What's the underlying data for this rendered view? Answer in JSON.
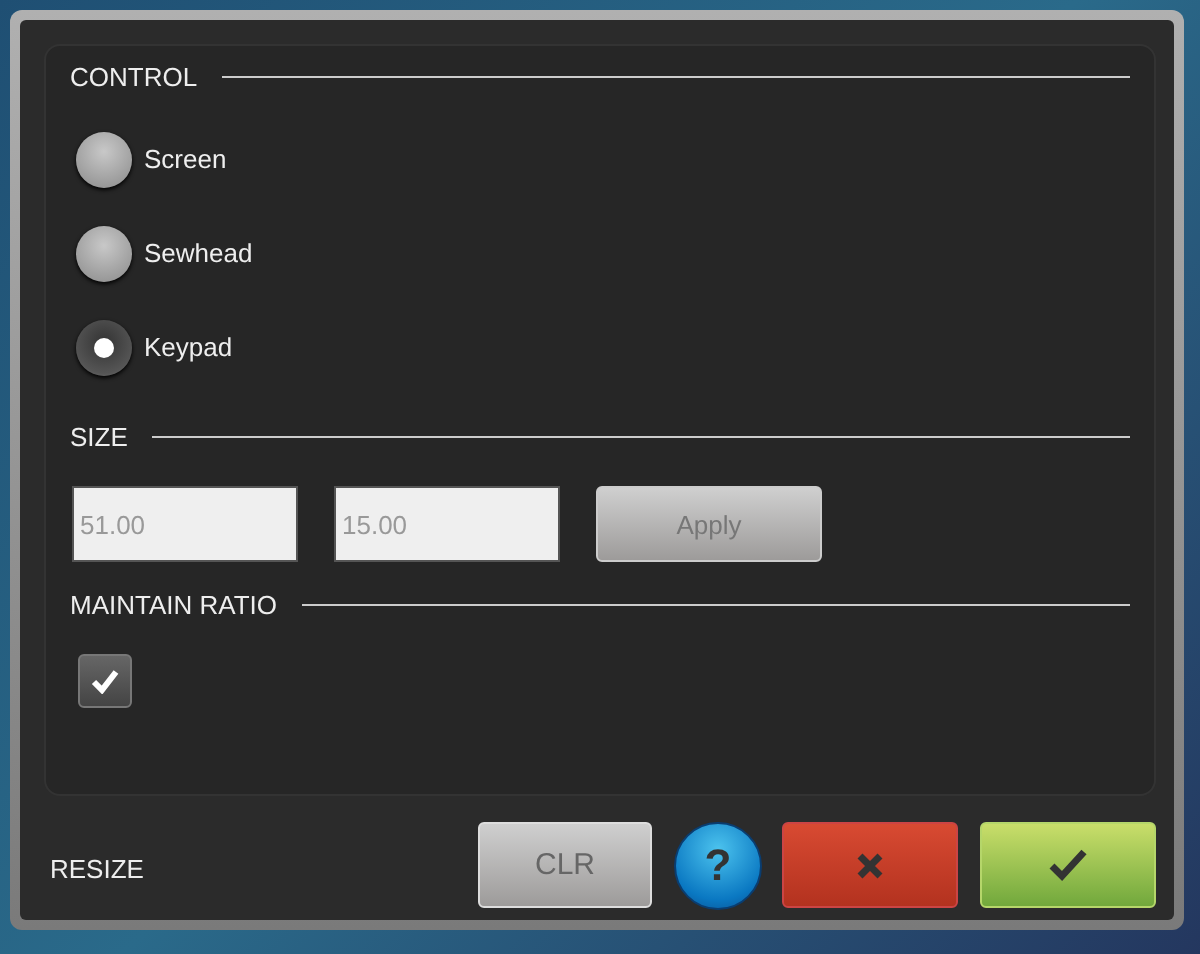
{
  "sections": [
    {
      "kind": "radios",
      "title": "CONTROL",
      "options": [
        {
          "label": "Screen",
          "selected": false
        },
        {
          "label": "Sewhead",
          "selected": false
        },
        {
          "label": "Keypad",
          "selected": true
        }
      ]
    },
    {
      "kind": "fields",
      "title": "SIZE",
      "fields": [
        {
          "value": "51.00"
        },
        {
          "value": "15.00"
        }
      ],
      "button": {
        "label": "Apply"
      }
    },
    {
      "kind": "checkbox",
      "title": "MAINTAIN RATIO",
      "checked": true
    }
  ],
  "footer": {
    "title": "RESIZE",
    "buttons": [
      {
        "kind": "clear",
        "label": "CLR"
      },
      {
        "kind": "help",
        "label": "?"
      },
      {
        "kind": "cancel"
      },
      {
        "kind": "ok"
      }
    ]
  }
}
